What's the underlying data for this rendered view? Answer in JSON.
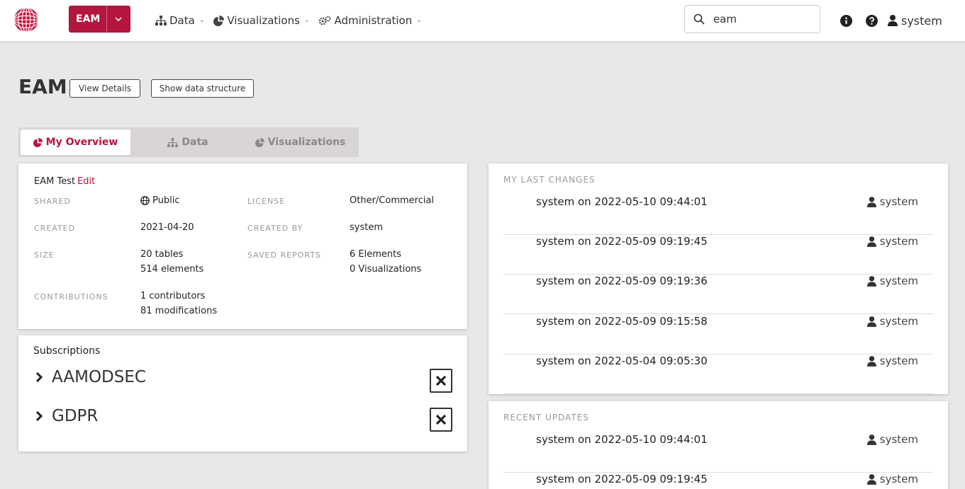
{
  "header": {
    "repo_label": "EAM",
    "nav": [
      {
        "label": "Data"
      },
      {
        "label": "Visualizations"
      },
      {
        "label": "Administration"
      }
    ],
    "search_value": "eam",
    "user": "system"
  },
  "page": {
    "title": "EAM",
    "view_details": "View Details",
    "show_structure": "Show data structure"
  },
  "tabs": [
    {
      "label": "My Overview",
      "active": true
    },
    {
      "label": "Data",
      "active": false
    },
    {
      "label": "Visualizations",
      "active": false
    }
  ],
  "info": {
    "name": "EAM Test",
    "edit": "Edit",
    "shared_label": "SHARED",
    "shared_value": "Public",
    "license_label": "LICENSE",
    "license_value": "Other/Commercial",
    "created_label": "CREATED",
    "created_value": "2021-04-20",
    "created_by_label": "CREATED BY",
    "created_by_value": "system",
    "size_label": "SIZE",
    "size_tables": "20 tables",
    "size_elements": "514 elements",
    "saved_label": "SAVED REPORTS",
    "saved_elements": "6 Elements",
    "saved_visualizations": "0 Visualizations",
    "contrib_label": "CONTRIBUTIONS",
    "contrib_count": "1 contributors",
    "contrib_mods": "81 modifications"
  },
  "subscriptions": {
    "title": "Subscriptions",
    "items": [
      {
        "name": "AAMODSEC"
      },
      {
        "name": "GDPR"
      }
    ]
  },
  "last_changes": {
    "title": "MY LAST CHANGES",
    "entries": [
      {
        "text": "system on 2022-05-10 09:44:01",
        "user": "system"
      },
      {
        "text": "system on 2022-05-09 09:19:45",
        "user": "system"
      },
      {
        "text": "system on 2022-05-09 09:19:36",
        "user": "system"
      },
      {
        "text": "system on 2022-05-09 09:15:58",
        "user": "system"
      },
      {
        "text": "system on 2022-05-04 09:05:30",
        "user": "system"
      }
    ]
  },
  "recent_updates": {
    "title": "RECENT UPDATES",
    "entries": [
      {
        "text": "system on 2022-05-10 09:44:01",
        "user": "system"
      },
      {
        "text": "system on 2022-05-09 09:19:45",
        "user": "system"
      }
    ]
  },
  "colors": {
    "brand": "#b5163f",
    "background": "#e8e8e8"
  }
}
